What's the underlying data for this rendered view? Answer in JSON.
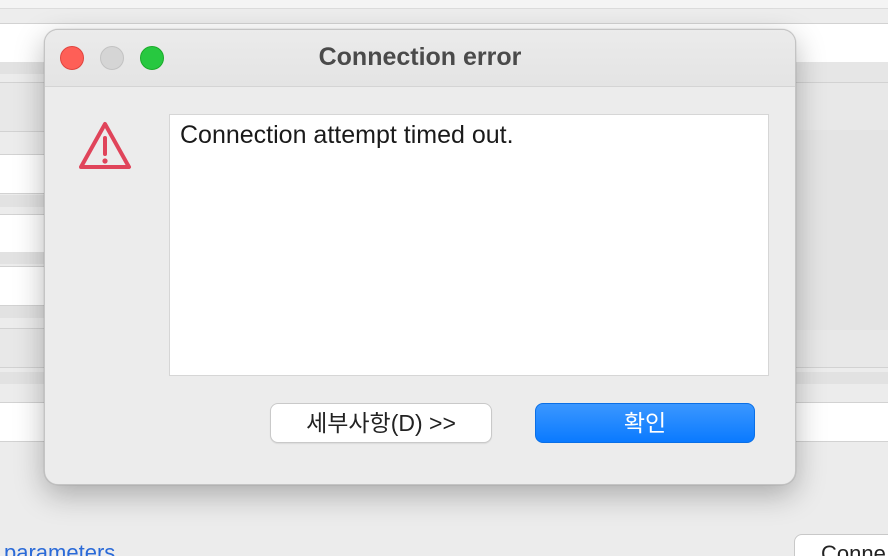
{
  "dialog": {
    "title": "Connection error",
    "message": "Connection attempt timed out.",
    "details_button_label": "세부사항(D) >>",
    "ok_button_label": "확인",
    "icon": "warning-triangle-icon"
  },
  "background_window": {
    "link_text": "parameters",
    "connect_button_label": "Conne"
  },
  "colors": {
    "accent": "#0a7aff",
    "warning": "#e0445a",
    "close": "#fe5f57",
    "zoom": "#27c840"
  }
}
